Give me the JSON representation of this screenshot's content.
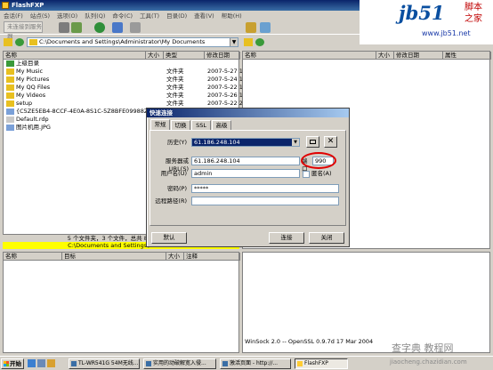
{
  "window": {
    "title": "FlashFXP"
  },
  "menu": {
    "items": [
      "会话(F)",
      "站点(S)",
      "选项(O)",
      "队列(Q)",
      "命令(C)",
      "工具(T)",
      "目录(D)",
      "查看(V)",
      "帮助(H)"
    ]
  },
  "toolbar": {
    "disconnected_label": "未连接到服务器"
  },
  "logo": {
    "brand": "jb51",
    "cn1": "脚本",
    "cn2": "之家",
    "url": "www.jb51.net"
  },
  "left_pane": {
    "path": "C:\\Documents and Settings\\Administrator\\My Documents",
    "columns": {
      "name": "名称",
      "size": "大小",
      "type": "类型",
      "modified": "修改日期"
    },
    "rows": [
      {
        "name": "上级目录",
        "type": "",
        "date": ""
      },
      {
        "name": "My Music",
        "type": "文件夹",
        "date": "2007-5-27 1:"
      },
      {
        "name": "My Pictures",
        "type": "文件夹",
        "date": "2007-5-24 1:"
      },
      {
        "name": "My QQ Files",
        "type": "文件夹",
        "date": "2007-5-22 1:"
      },
      {
        "name": "My Videos",
        "type": "文件夹",
        "date": "2007-5-26 1:"
      },
      {
        "name": "setup",
        "type": "文件夹",
        "date": "2007-5-22 2:"
      },
      {
        "name": "{C5ZE5EB4-8CCF-4E0A-8S1C-5Z8BFE09988Z}.BMP",
        "type": "",
        "date": ""
      },
      {
        "name": "Default.rdp",
        "type": "",
        "date": ""
      },
      {
        "name": "图片机用.JPG",
        "type": "",
        "date": ""
      }
    ],
    "status": "5 个文件夹，3 个文件，总共 8 (213 KB)",
    "status_path": "C:\\Documents and Settings\\Administ"
  },
  "right_pane": {
    "columns": {
      "name": "名称",
      "size": "大小",
      "modified": "修改日期",
      "attr": "属性"
    }
  },
  "queue": {
    "columns": {
      "name": "名称",
      "target": "目标",
      "size": "大小",
      "note": "注释"
    }
  },
  "log": {
    "line": "WinSock 2.0 -- OpenSSL 0.9.7d 17 Mar 2004"
  },
  "dialog": {
    "title": "快速连接",
    "tabs": [
      "常规",
      "切换",
      "SSL",
      "高级"
    ],
    "history_label": "历史(Y)",
    "history_value": "61.186.248.104",
    "server_label": "服务器或URL(S)",
    "server_value": "61.186.248.104",
    "port_label": "端口",
    "port_value": "990",
    "user_label": "用户名(U)",
    "user_value": "admin",
    "anon_label": "匿名(A)",
    "password_label": "密码(P)",
    "password_value": "*****",
    "remote_label": "远程路径(R)",
    "remote_value": "",
    "default_btn": "默认",
    "connect_btn": "连接",
    "close_btn": "关闭"
  },
  "taskbar": {
    "start": "开始",
    "tasks": [
      "TL-WR541G 54M无线...",
      "实用的动破解宽入侵...",
      "激活页面 - http://...",
      "FlashFXP"
    ]
  },
  "watermark": {
    "text": "查字典 教程网",
    "url": "jiaocheng.chazidian.com"
  }
}
